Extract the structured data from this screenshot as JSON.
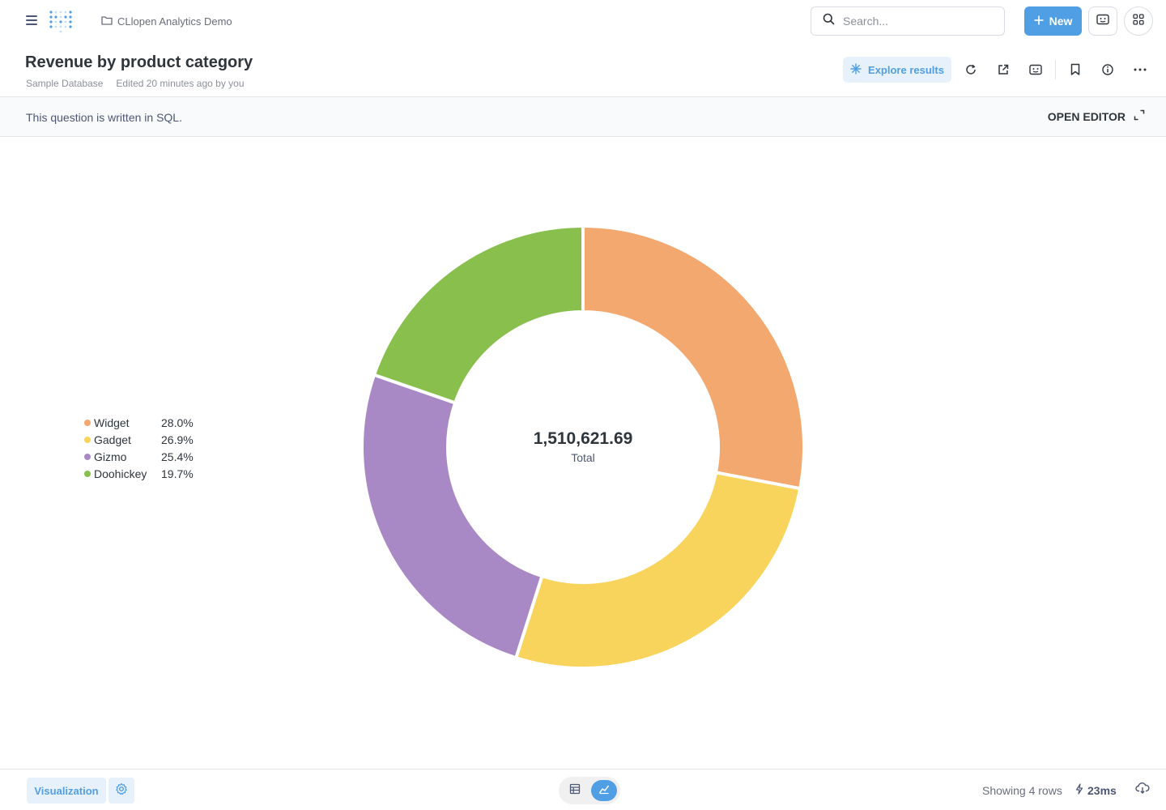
{
  "nav": {
    "collection": "CLlopen Analytics Demo",
    "search_placeholder": "Search...",
    "new_label": "New"
  },
  "header": {
    "title": "Revenue by product category",
    "database": "Sample Database",
    "edited": "Edited 20 minutes ago by you",
    "explore_label": "Explore results"
  },
  "sqlbar": {
    "text": "This question is written in SQL.",
    "open_editor": "OPEN EDITOR"
  },
  "colors": {
    "accent": "#509ee3",
    "widget": "#f2a86f",
    "gadget": "#f9d45c",
    "gizmo": "#a989c5",
    "doohickey": "#88bf4d"
  },
  "chart_data": {
    "type": "pie",
    "donut": true,
    "center_value": "1,510,621.69",
    "center_label": "Total",
    "total": 1510621.69,
    "legend_position": "left",
    "categories": [
      "Widget",
      "Gadget",
      "Gizmo",
      "Doohickey"
    ],
    "percents": [
      "28.0%",
      "26.9%",
      "25.4%",
      "19.7%"
    ],
    "values": [
      28.0,
      26.9,
      25.4,
      19.7
    ],
    "colors": [
      "#f2a86f",
      "#f9d45c",
      "#a989c5",
      "#88bf4d"
    ]
  },
  "footer": {
    "visualization_label": "Visualization",
    "rows_text": "Showing 4 rows",
    "timing": "23ms"
  }
}
